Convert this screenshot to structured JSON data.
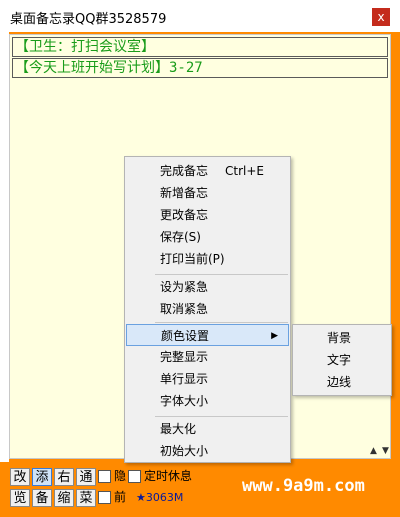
{
  "window": {
    "title": "桌面备忘录QQ群3528579",
    "close_label": "x"
  },
  "memos": [
    "【卫生：打扫会议室】",
    "【今天上班开始写计划】3-27"
  ],
  "context_menu": {
    "items": [
      {
        "label": "完成备忘",
        "shortcut": "Ctrl+E"
      },
      {
        "label": "新增备忘"
      },
      {
        "label": "更改备忘"
      },
      {
        "label": "保存(S)"
      },
      {
        "label": "打印当前(P)"
      },
      {
        "label": "设为紧急"
      },
      {
        "label": "取消紧急"
      },
      {
        "label": "颜色设置",
        "submenu_arrow": "▶"
      },
      {
        "label": "完整显示"
      },
      {
        "label": "单行显示"
      },
      {
        "label": "字体大小"
      },
      {
        "label": "最大化"
      },
      {
        "label": "初始大小"
      }
    ],
    "highlighted": "颜色设置"
  },
  "color_submenu": {
    "items": [
      "背景",
      "文字",
      "边线"
    ]
  },
  "toolbar": {
    "row1": [
      "改",
      "添",
      "右",
      "通"
    ],
    "row2": [
      "览",
      "备",
      "缩",
      "菜"
    ],
    "hide_label": "隐",
    "timer_label": "定时休息",
    "front_label": "前",
    "status_text": "★3063M"
  },
  "watermark": "www.9a9m.com"
}
